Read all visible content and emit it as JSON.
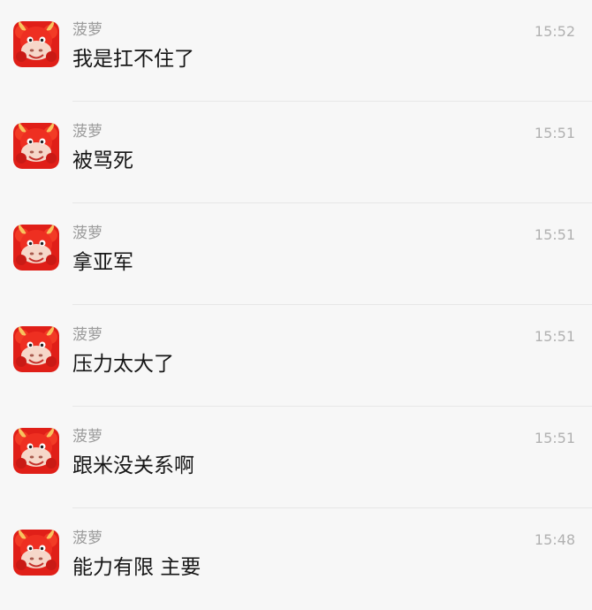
{
  "messages": [
    {
      "sender": "菠萝",
      "time": "15:52",
      "text": "我是扛不住了",
      "avatar": "red-cartoon-ox-avatar"
    },
    {
      "sender": "菠萝",
      "time": "15:51",
      "text": "被骂死",
      "avatar": "red-cartoon-ox-avatar"
    },
    {
      "sender": "菠萝",
      "time": "15:51",
      "text": "拿亚军",
      "avatar": "red-cartoon-ox-avatar"
    },
    {
      "sender": "菠萝",
      "time": "15:51",
      "text": "压力太大了",
      "avatar": "red-cartoon-ox-avatar"
    },
    {
      "sender": "菠萝",
      "time": "15:51",
      "text": "跟米没关系啊",
      "avatar": "red-cartoon-ox-avatar"
    },
    {
      "sender": "菠萝",
      "time": "15:48",
      "text": "能力有限 主要",
      "avatar": "red-cartoon-ox-avatar"
    }
  ],
  "colors": {
    "background": "#f7f7f7",
    "name_text": "#9b9b9b",
    "time_text": "#b1b1b1",
    "message_text": "#161616",
    "avatar_red": "#d81f1a"
  }
}
